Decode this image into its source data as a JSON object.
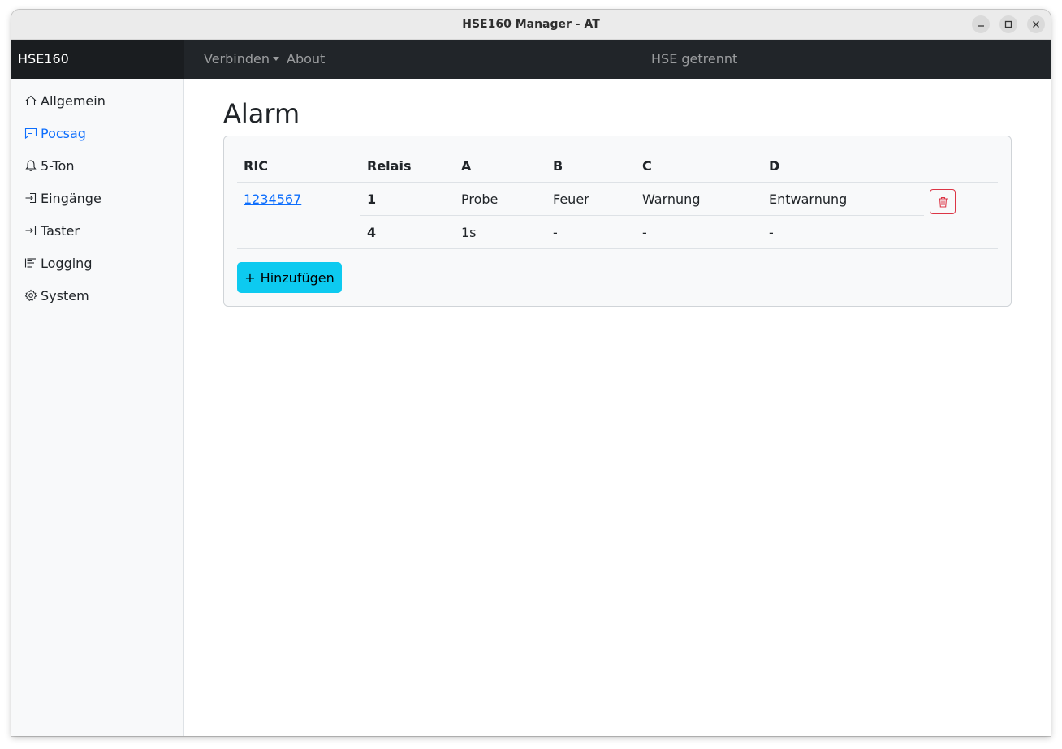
{
  "window": {
    "title": "HSE160 Manager - AT"
  },
  "navbar": {
    "brand": "HSE160",
    "connect_label": "Verbinden",
    "about_label": "About",
    "status": "HSE getrennt"
  },
  "sidebar": {
    "items": [
      {
        "label": "Allgemein",
        "icon": "house-icon"
      },
      {
        "label": "Pocsag",
        "icon": "message-icon",
        "active": true
      },
      {
        "label": "5-Ton",
        "icon": "bell-icon"
      },
      {
        "label": "Eingänge",
        "icon": "input-icon"
      },
      {
        "label": "Taster",
        "icon": "input-icon"
      },
      {
        "label": "Logging",
        "icon": "log-icon"
      },
      {
        "label": "System",
        "icon": "gear-icon"
      }
    ]
  },
  "main": {
    "title": "Alarm",
    "table": {
      "headers": [
        "RIC",
        "Relais",
        "A",
        "B",
        "C",
        "D"
      ],
      "ric": "1234567",
      "rows": [
        {
          "relais": "1",
          "a": "Probe",
          "b": "Feuer",
          "c": "Warnung",
          "d": "Entwarnung"
        },
        {
          "relais": "4",
          "a": "1s",
          "b": "-",
          "c": "-",
          "d": "-"
        }
      ]
    },
    "add_label": "Hinzufügen",
    "add_prefix": "+"
  },
  "colors": {
    "accent": "#0d6efd",
    "navbar": "#212529",
    "add_button": "#0dcaf0",
    "danger": "#dc3545"
  }
}
